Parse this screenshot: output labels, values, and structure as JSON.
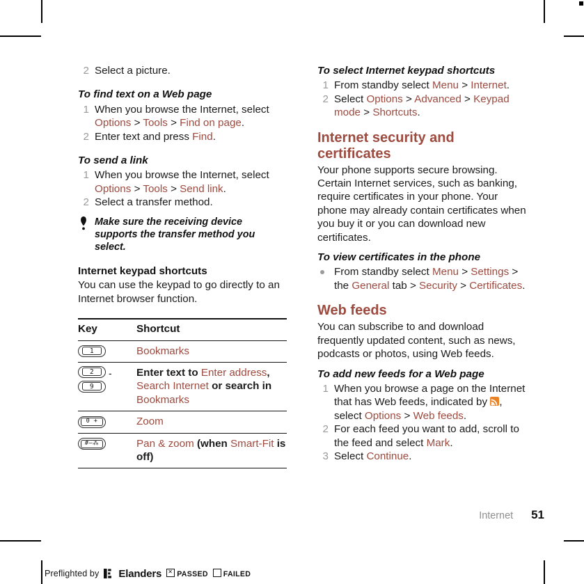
{
  "page": {
    "section_label": "Internet",
    "page_number": "51"
  },
  "left_column": {
    "lead_step": {
      "num": "2",
      "text": "Select a picture."
    },
    "task_find_text": {
      "heading": "To find text on a Web page",
      "steps": [
        {
          "num": "1",
          "parts": [
            {
              "t": "When you browse the Internet, select ",
              "style": "plain"
            },
            {
              "t": "Options",
              "style": "red"
            },
            {
              "t": " > ",
              "style": "plain"
            },
            {
              "t": "Tools",
              "style": "red"
            },
            {
              "t": " > ",
              "style": "plain"
            },
            {
              "t": "Find on page",
              "style": "red"
            },
            {
              "t": ".",
              "style": "plain"
            }
          ]
        },
        {
          "num": "2",
          "parts": [
            {
              "t": "Enter text and press ",
              "style": "plain"
            },
            {
              "t": "Find",
              "style": "red"
            },
            {
              "t": ".",
              "style": "plain"
            }
          ]
        }
      ]
    },
    "task_send_link": {
      "heading": "To send a link",
      "steps": [
        {
          "num": "1",
          "parts": [
            {
              "t": "When you browse the Internet, select ",
              "style": "plain"
            },
            {
              "t": "Options",
              "style": "red"
            },
            {
              "t": " > ",
              "style": "plain"
            },
            {
              "t": "Tools",
              "style": "red"
            },
            {
              "t": " > ",
              "style": "plain"
            },
            {
              "t": "Send link",
              "style": "red"
            },
            {
              "t": ".",
              "style": "plain"
            }
          ]
        },
        {
          "num": "2",
          "parts": [
            {
              "t": "Select a transfer method.",
              "style": "plain"
            }
          ]
        }
      ]
    },
    "note": {
      "icon": "tip-icon",
      "text": "Make sure the receiving device supports the transfer method you select."
    },
    "keypad_shortcuts": {
      "heading": "Internet keypad shortcuts",
      "body": "You can use the keypad to go directly to an Internet browser function."
    },
    "key_table": {
      "columns": [
        "Key",
        "Shortcut"
      ],
      "rows": [
        {
          "keys": [
            "1"
          ],
          "range": false,
          "shortcut_parts": [
            {
              "t": "Bookmarks",
              "style": "red"
            }
          ]
        },
        {
          "keys": [
            "2",
            "9"
          ],
          "range": true,
          "range_dash": "-",
          "shortcut_parts": [
            {
              "t": "Enter text to ",
              "style": "bold"
            },
            {
              "t": "Enter address",
              "style": "red"
            },
            {
              "t": ", ",
              "style": "bold"
            },
            {
              "t": "Search Internet",
              "style": "red"
            },
            {
              "t": " or search in ",
              "style": "bold"
            },
            {
              "t": "Bookmarks",
              "style": "red"
            }
          ]
        },
        {
          "keys": [
            "0 +"
          ],
          "range": false,
          "shortcut_parts": [
            {
              "t": "Zoom",
              "style": "red"
            }
          ]
        },
        {
          "keys": [
            "#–⁂"
          ],
          "range": false,
          "shortcut_parts": [
            {
              "t": "Pan & zoom",
              "style": "red"
            },
            {
              "t": " (when ",
              "style": "bold"
            },
            {
              "t": "Smart-Fit",
              "style": "red"
            },
            {
              "t": " is off)",
              "style": "bold"
            }
          ]
        }
      ]
    }
  },
  "right_column": {
    "task_select_shortcuts": {
      "heading": "To select Internet keypad shortcuts",
      "steps": [
        {
          "num": "1",
          "parts": [
            {
              "t": "From standby select ",
              "style": "plain"
            },
            {
              "t": "Menu",
              "style": "red"
            },
            {
              "t": " > ",
              "style": "plain"
            },
            {
              "t": "Internet",
              "style": "red"
            },
            {
              "t": ".",
              "style": "plain"
            }
          ]
        },
        {
          "num": "2",
          "parts": [
            {
              "t": "Select ",
              "style": "plain"
            },
            {
              "t": "Options",
              "style": "red"
            },
            {
              "t": " > ",
              "style": "plain"
            },
            {
              "t": "Advanced",
              "style": "red"
            },
            {
              "t": " > ",
              "style": "plain"
            },
            {
              "t": "Keypad mode",
              "style": "red"
            },
            {
              "t": " > ",
              "style": "plain"
            },
            {
              "t": "Shortcuts",
              "style": "red"
            },
            {
              "t": ".",
              "style": "plain"
            }
          ]
        }
      ]
    },
    "security_section": {
      "heading": "Internet security and certificates",
      "body": "Your phone supports secure browsing. Certain Internet services, such as banking, require certificates in your phone. Your phone may already contain certificates when you buy it or you can download new certificates.",
      "task": {
        "heading": "To view certificates in the phone",
        "bullets": [
          {
            "parts": [
              {
                "t": "From standby select ",
                "style": "plain"
              },
              {
                "t": "Menu",
                "style": "red"
              },
              {
                "t": " > ",
                "style": "plain"
              },
              {
                "t": "Settings",
                "style": "red"
              },
              {
                "t": " > the ",
                "style": "plain"
              },
              {
                "t": "General",
                "style": "red"
              },
              {
                "t": " tab > ",
                "style": "plain"
              },
              {
                "t": "Security",
                "style": "red"
              },
              {
                "t": " > ",
                "style": "plain"
              },
              {
                "t": "Certificates",
                "style": "red"
              },
              {
                "t": ".",
                "style": "plain"
              }
            ]
          }
        ]
      }
    },
    "webfeeds_section": {
      "heading": "Web feeds",
      "body": "You can subscribe to and download frequently updated content, such as news, podcasts or photos, using Web feeds.",
      "task": {
        "heading": "To add new feeds for a Web page",
        "steps": [
          {
            "num": "1",
            "parts": [
              {
                "t": "When you browse a page on the Internet that has Web feeds, indicated by ",
                "style": "plain"
              },
              {
                "t": "",
                "style": "rss-icon"
              },
              {
                "t": ", select ",
                "style": "plain"
              },
              {
                "t": "Options",
                "style": "red"
              },
              {
                "t": " > ",
                "style": "plain"
              },
              {
                "t": "Web feeds",
                "style": "red"
              },
              {
                "t": ".",
                "style": "plain"
              }
            ]
          },
          {
            "num": "2",
            "parts": [
              {
                "t": "For each feed you want to add, scroll to the feed and select ",
                "style": "plain"
              },
              {
                "t": "Mark",
                "style": "red"
              },
              {
                "t": ".",
                "style": "plain"
              }
            ]
          },
          {
            "num": "3",
            "parts": [
              {
                "t": "Select ",
                "style": "plain"
              },
              {
                "t": "Continue",
                "style": "red"
              },
              {
                "t": ".",
                "style": "plain"
              }
            ]
          }
        ]
      }
    }
  },
  "preflight": {
    "label": "Preflighted by",
    "brand": "Elanders",
    "brand_mark": "elanders-logo-icon",
    "passed_label": "PASSED",
    "passed_checked": true,
    "failed_label": "FAILED",
    "failed_checked": false
  },
  "colors": {
    "accent_red": "#9d4a3f",
    "step_number_grey": "#9a9a9a",
    "rss_orange": "#e98328",
    "text_black": "#1a1a1a"
  }
}
